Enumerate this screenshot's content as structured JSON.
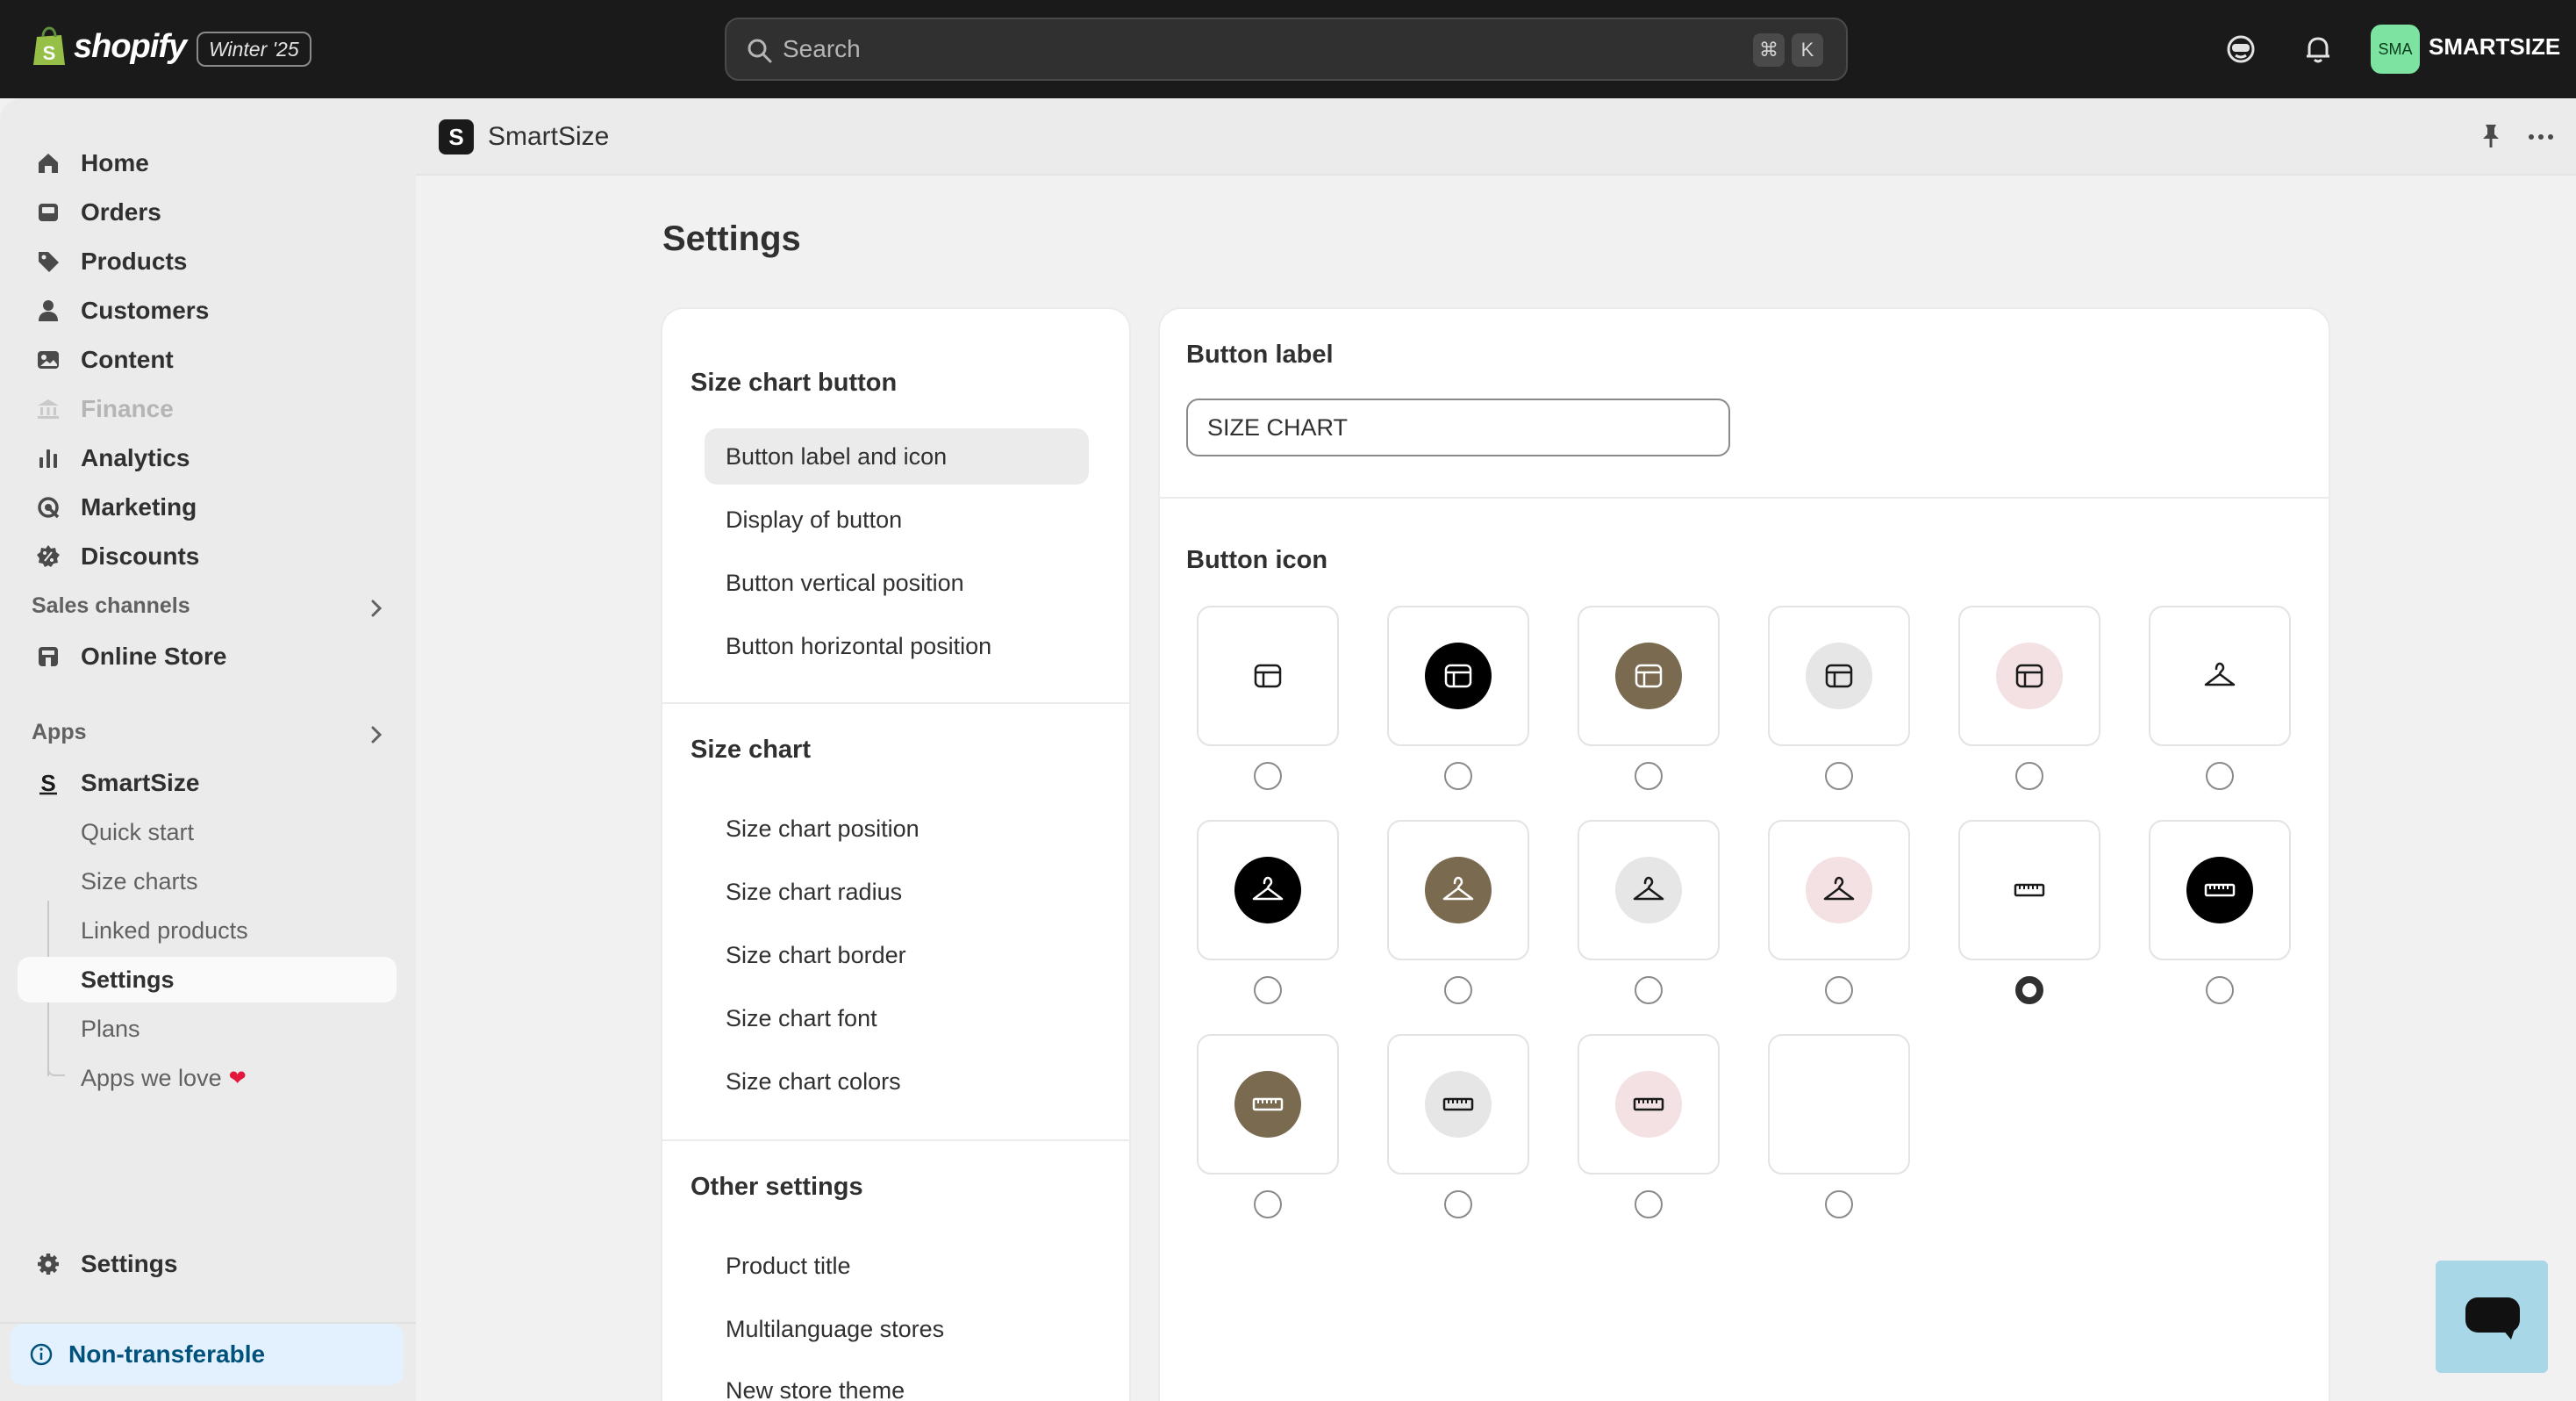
{
  "topbar": {
    "brand": "shopify",
    "edition": "Winter '25",
    "search_placeholder": "Search",
    "shortcut_cmd": "⌘",
    "shortcut_key": "K",
    "avatar_initials": "SMA",
    "store_name": "SMARTSIZE"
  },
  "sidebar": {
    "nav": [
      {
        "label": "Home",
        "icon": "home-icon"
      },
      {
        "label": "Orders",
        "icon": "orders-icon"
      },
      {
        "label": "Products",
        "icon": "tag-icon"
      },
      {
        "label": "Customers",
        "icon": "person-icon"
      },
      {
        "label": "Content",
        "icon": "image-icon"
      },
      {
        "label": "Finance",
        "icon": "bank-icon",
        "disabled": true
      },
      {
        "label": "Analytics",
        "icon": "bar-chart-icon"
      },
      {
        "label": "Marketing",
        "icon": "target-icon"
      },
      {
        "label": "Discounts",
        "icon": "discount-icon"
      }
    ],
    "sales_channels_title": "Sales channels",
    "online_store": "Online Store",
    "apps_title": "Apps",
    "app_name": "SmartSize",
    "app_subitems": [
      "Quick start",
      "Size charts",
      "Linked products",
      "Settings",
      "Plans",
      "Apps we love"
    ],
    "active_subitem": "Settings",
    "settings_label": "Settings",
    "notice": "Non-transferable"
  },
  "app_header": {
    "logo_letter": "S",
    "title": "SmartSize"
  },
  "page": {
    "title": "Settings"
  },
  "settings_nav": {
    "sections": [
      {
        "title": "Size chart button",
        "items": [
          "Button label and icon",
          "Display of button",
          "Button vertical position",
          "Button horizontal position"
        ]
      },
      {
        "title": "Size chart",
        "items": [
          "Size chart position",
          "Size chart radius",
          "Size chart border",
          "Size chart font",
          "Size chart colors"
        ]
      },
      {
        "title": "Other settings",
        "items": [
          "Product title",
          "Multilanguage stores",
          "New store theme"
        ]
      }
    ],
    "active_item": "Button label and icon"
  },
  "button_settings": {
    "label_title": "Button label",
    "label_value": "SIZE CHART",
    "icon_title": "Button icon",
    "selected_index": 10,
    "icons": [
      {
        "name": "table-icon",
        "bg": "none"
      },
      {
        "name": "table-icon",
        "bg": "#000000"
      },
      {
        "name": "table-icon",
        "bg": "#7a6a4f"
      },
      {
        "name": "table-icon",
        "bg": "#e6e6e6"
      },
      {
        "name": "table-icon",
        "bg": "#f3e1e3"
      },
      {
        "name": "hanger-icon",
        "bg": "none"
      },
      {
        "name": "hanger-icon",
        "bg": "#000000"
      },
      {
        "name": "hanger-icon",
        "bg": "#7a6a4f"
      },
      {
        "name": "hanger-icon",
        "bg": "#e6e6e6"
      },
      {
        "name": "hanger-icon",
        "bg": "#f3e1e3"
      },
      {
        "name": "ruler-icon",
        "bg": "none"
      },
      {
        "name": "ruler-icon",
        "bg": "#000000"
      },
      {
        "name": "ruler-icon",
        "bg": "#7a6a4f"
      },
      {
        "name": "ruler-icon",
        "bg": "#e6e6e6"
      },
      {
        "name": "ruler-icon",
        "bg": "#f3e1e3"
      },
      {
        "name": "no-icon",
        "bg": "none"
      }
    ]
  },
  "colors": {
    "topbar": "#1a1a1a",
    "sidebar": "#ebebeb",
    "notice_bg": "#e3f1fe",
    "notice_text": "#00527c",
    "chat_button": "#a8d8e8"
  }
}
